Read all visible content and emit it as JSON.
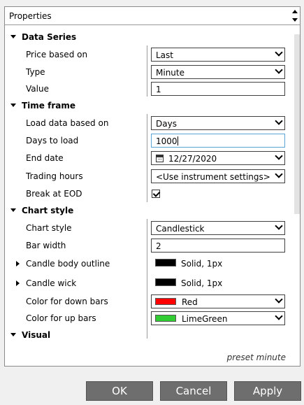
{
  "header": {
    "title": "Properties"
  },
  "data_series": {
    "title": "Data Series",
    "price_based_on": {
      "label": "Price based on",
      "value": "Last"
    },
    "type": {
      "label": "Type",
      "value": "Minute"
    },
    "value": {
      "label": "Value",
      "value": "1"
    }
  },
  "time_frame": {
    "title": "Time frame",
    "load_based_on": {
      "label": "Load data based on",
      "value": "Days"
    },
    "days_to_load": {
      "label": "Days to load",
      "value": "1000"
    },
    "end_date": {
      "label": "End date",
      "value": "12/27/2020"
    },
    "trading_hours": {
      "label": "Trading hours",
      "value": "<Use instrument settings>"
    },
    "break_eod": {
      "label": "Break at EOD",
      "checked": true
    }
  },
  "chart_style": {
    "title": "Chart style",
    "style": {
      "label": "Chart style",
      "value": "Candlestick"
    },
    "bar_width": {
      "label": "Bar width",
      "value": "2"
    },
    "body_outline": {
      "label": "Candle body outline",
      "value": "Solid, 1px",
      "color": "#000000"
    },
    "wick": {
      "label": "Candle wick",
      "value": "Solid, 1px",
      "color": "#000000"
    },
    "down_bars": {
      "label": "Color for down bars",
      "value": "Red",
      "color": "#ff0000"
    },
    "up_bars": {
      "label": "Color for up bars",
      "value": "LimeGreen",
      "color": "#32cd32"
    }
  },
  "visual": {
    "title": "Visual"
  },
  "footer": {
    "preset": "preset minute"
  },
  "buttons": {
    "ok": "OK",
    "cancel": "Cancel",
    "apply": "Apply"
  }
}
